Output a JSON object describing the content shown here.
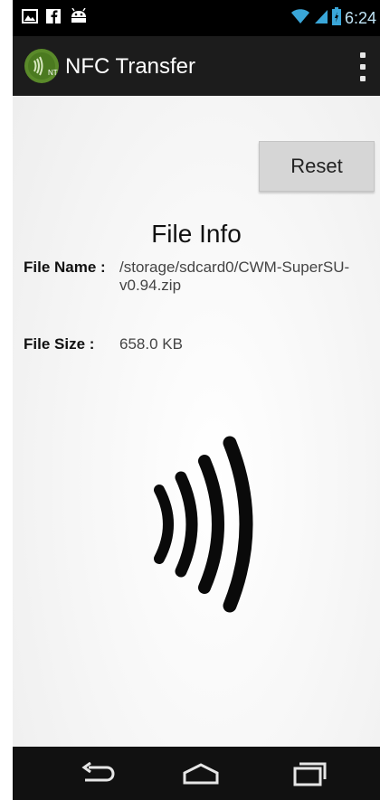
{
  "status_bar": {
    "time": "6:24",
    "left_icons": [
      "gallery-icon",
      "facebook-icon",
      "android-icon"
    ],
    "right_icons": [
      "wifi-icon",
      "signal-icon",
      "battery-icon"
    ]
  },
  "action_bar": {
    "title": "NFC Transfer",
    "logo_icon": "nfc-app-logo",
    "overflow_icon": "overflow-menu-icon"
  },
  "reset_button": {
    "label": "Reset"
  },
  "file_info": {
    "title": "File Info",
    "name_label": "File Name :",
    "name_value_line1": "/storage/sdcard0/CWM-SuperSU-",
    "name_value_line2": "v0.94.zip",
    "size_label": "File Size :",
    "size_value": "658.0 KB"
  },
  "nfc_graphic": {
    "icon": "nfc-waves-icon"
  },
  "nav_bar": {
    "back_icon": "back-icon",
    "home_icon": "home-icon",
    "recents_icon": "recents-icon"
  },
  "colors": {
    "status_bar": "#000000",
    "action_bar": "#1c1c1c",
    "button": "#d6d6d6",
    "nav_bar": "#111111",
    "time_text": "#bfe3f5"
  }
}
